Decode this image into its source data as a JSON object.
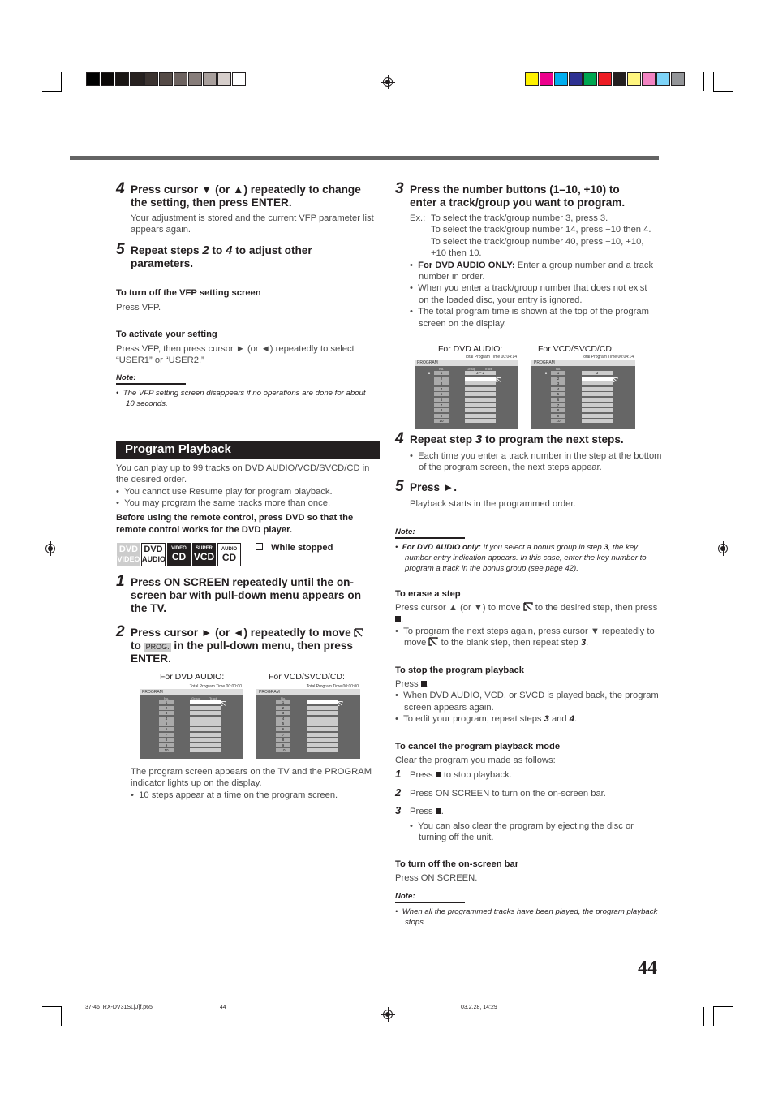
{
  "print_marks": {
    "gray_bars": [
      "#000000",
      "#0a0807",
      "#1a1614",
      "#27211f",
      "#3b3330",
      "#544a46",
      "#6c625f",
      "#877d7a",
      "#a89f9c",
      "#d6cecb",
      "#ffffff"
    ],
    "color_bars": [
      "#fff200",
      "#ec008c",
      "#00aeef",
      "#2e3192",
      "#00a651",
      "#ed1c24",
      "#231f20",
      "#fff57f",
      "#f384c3",
      "#7dd3f7",
      "#939598"
    ]
  },
  "left": {
    "step4": {
      "num": "4",
      "title_a": "Press cursor ▼ (or ▲) repeatedly to change",
      "title_b": "the setting, then press ENTER.",
      "body": "Your adjustment is stored and the current VFP parameter list appears again."
    },
    "step5": {
      "num": "5",
      "title_pre": "Repeat steps ",
      "s1": "2",
      "mid": " to ",
      "s2": "4",
      "title_post": " to adjust other",
      "title_b": "parameters."
    },
    "vfp_off": {
      "heading": "To turn off the VFP setting screen",
      "body": "Press VFP."
    },
    "activate": {
      "heading": "To activate your setting",
      "body_a": "Press VFP, then press cursor ► (or ◄) repeatedly to select",
      "body_b": "“USER1” or “USER2.”"
    },
    "note1": {
      "label": "Note:",
      "items": [
        "The VFP setting screen disappears if no operations are done for about 10 seconds."
      ]
    },
    "section_title": "Program Playback",
    "intro": "You can play up to 99 tracks on DVD AUDIO/VCD/SVCD/CD in the desired order.",
    "bullets": [
      "You cannot use Resume play for program playback.",
      "You may program the same tracks more than once."
    ],
    "remote_note": "Before using the remote control, press DVD so that the remote control works for the DVD player.",
    "badges": [
      {
        "top": "DVD",
        "bottom": "VIDEO",
        "state": "inactive"
      },
      {
        "top": "DVD",
        "bottom": "AUDIO",
        "state": "outline"
      },
      {
        "top": "VIDEO",
        "bottom": "CD",
        "state": "filled"
      },
      {
        "top": "SUPER",
        "bottom": "VCD",
        "state": "filled"
      },
      {
        "top": "AUDIO",
        "bottom": "CD",
        "state": "outline"
      }
    ],
    "while_stopped": "While stopped",
    "step1": {
      "num": "1",
      "title": "Press ON SCREEN repeatedly until the on-screen bar with pull-down menu appears on the TV."
    },
    "step2": {
      "num": "2",
      "title_a": "Press cursor ► (or ◄) repeatedly to move",
      "to": "to",
      "prog": "PROG.",
      "title_b": "in the pull-down menu, then press",
      "title_c": "ENTER."
    },
    "screens": {
      "caption_dvd": "For DVD AUDIO:",
      "caption_vcd": "For VCD/SVCD/CD:",
      "dvd": {
        "tab": "PROGRAM",
        "total": "Total Program Time 00:00:00",
        "col_no": "No.",
        "col_group": "Group",
        "col_track": "Track",
        "steps": [
          "1",
          "2",
          "3",
          "4",
          "5",
          "6",
          "7",
          "8",
          "9",
          "10"
        ],
        "entries": [
          "",
          "",
          "",
          "",
          "",
          "",
          "",
          "",
          "",
          ""
        ]
      },
      "vcd": {
        "tab": "PROGRAM",
        "total": "Total Program Time 00:00:00",
        "col_no": "No.",
        "steps": [
          "1",
          "2",
          "3",
          "4",
          "5",
          "6",
          "7",
          "8",
          "9",
          "10"
        ],
        "entries": [
          "",
          "",
          "",
          "",
          "",
          "",
          "",
          "",
          "",
          ""
        ]
      }
    },
    "after_screens": "The program screen appears on the TV and the PROGRAM indicator lights up on the display.",
    "after_bullet": "10 steps appear at a time on the program screen."
  },
  "right": {
    "step3": {
      "num": "3",
      "title_a": "Press the number buttons (1–10, +10) to",
      "title_b": "enter a track/group you want to program.",
      "ex_label": "Ex.:",
      "examples": [
        "To select the track/group number 3, press 3.",
        "To select the track/group number 14, press +10 then 4.",
        "To select the track/group number 40, press +10, +10, +10 then 10."
      ],
      "bullet1_bold": "For DVD AUDIO ONLY:",
      "bullet1": " Enter a group number and a track number in order.",
      "bullet2": "When you enter a track/group number that does not exist on the loaded disc, your entry is ignored.",
      "bullet3": "The total program time is shown at the top of the program screen on the display."
    },
    "screens": {
      "caption_dvd": "For DVD AUDIO:",
      "caption_vcd": "For VCD/SVCD/CD:",
      "dvd": {
        "tab": "PROGRAM",
        "total": "Total Program Time 00:04:14",
        "col_no": "No.",
        "col_group": "Group",
        "col_track": "Track",
        "steps": [
          "1",
          "2",
          "3",
          "4",
          "5",
          "6",
          "7",
          "8",
          "9",
          "10"
        ],
        "entries": [
          "3  –  2",
          "",
          "",
          "",
          "",
          "",
          "",
          "",
          "",
          ""
        ]
      },
      "vcd": {
        "tab": "PROGRAM",
        "total": "Total Program Time 00:04:14",
        "col_no": "No.",
        "steps": [
          "1",
          "2",
          "3",
          "4",
          "5",
          "6",
          "7",
          "8",
          "9",
          "10"
        ],
        "entries": [
          "3",
          "",
          "",
          "",
          "",
          "",
          "",
          "",
          "",
          ""
        ]
      }
    },
    "step4": {
      "num": "4",
      "title_pre": "Repeat step ",
      "s": "3",
      "title_post": " to program the next steps.",
      "bullet": "Each time you enter a track number in the step at the bottom of the program screen, the next steps appear."
    },
    "step5": {
      "num": "5",
      "title": "Press ►.",
      "body": "Playback starts in the programmed order."
    },
    "note2": {
      "label": "Note:",
      "bold": "For DVD AUDIO only:",
      "text_a": "  If you select a bonus group in step ",
      "s": "3",
      "text_b": ", the key number entry indication appears. In this case, enter the key number to program a track in the bonus group (see page 42)."
    },
    "erase": {
      "heading": "To erase a step",
      "body_a": "Press cursor ▲ (or ▼) to move",
      "body_b": "to the desired step, then press",
      "bullet_a": "To program the next steps again, press cursor ▼ repeatedly to move",
      "bullet_b": "to the blank step, then repeat step ",
      "s": "3"
    },
    "stop": {
      "heading": "To stop the program playback",
      "body": "Press",
      "bullet1": "When DVD AUDIO, VCD, or SVCD is played back, the program screen appears again.",
      "bullet2_a": "To edit your program, repeat steps ",
      "s1": "3",
      "and": " and ",
      "s2": "4"
    },
    "cancel": {
      "heading": "To cancel the program playback mode",
      "intro": "Clear the program you made as follows:",
      "steps": [
        {
          "num": "1",
          "a": "Press",
          "b": "to stop playback."
        },
        {
          "num": "2",
          "a": "Press ON SCREEN to turn on the on-screen bar."
        },
        {
          "num": "3",
          "a": "Press"
        }
      ],
      "bullet": "You can also clear the program by ejecting the disc or turning off the unit."
    },
    "onscreen_off": {
      "heading": "To turn off the on-screen bar",
      "body": "Press ON SCREEN."
    },
    "note3": {
      "label": "Note:",
      "items": [
        "When all the programmed tracks have been played, the program playback stops."
      ]
    }
  },
  "page_number": "44",
  "footer": {
    "file": "37-46_RX-DV31SL[J]f.p65",
    "page": "44",
    "date": "03.2.28, 14:29"
  }
}
